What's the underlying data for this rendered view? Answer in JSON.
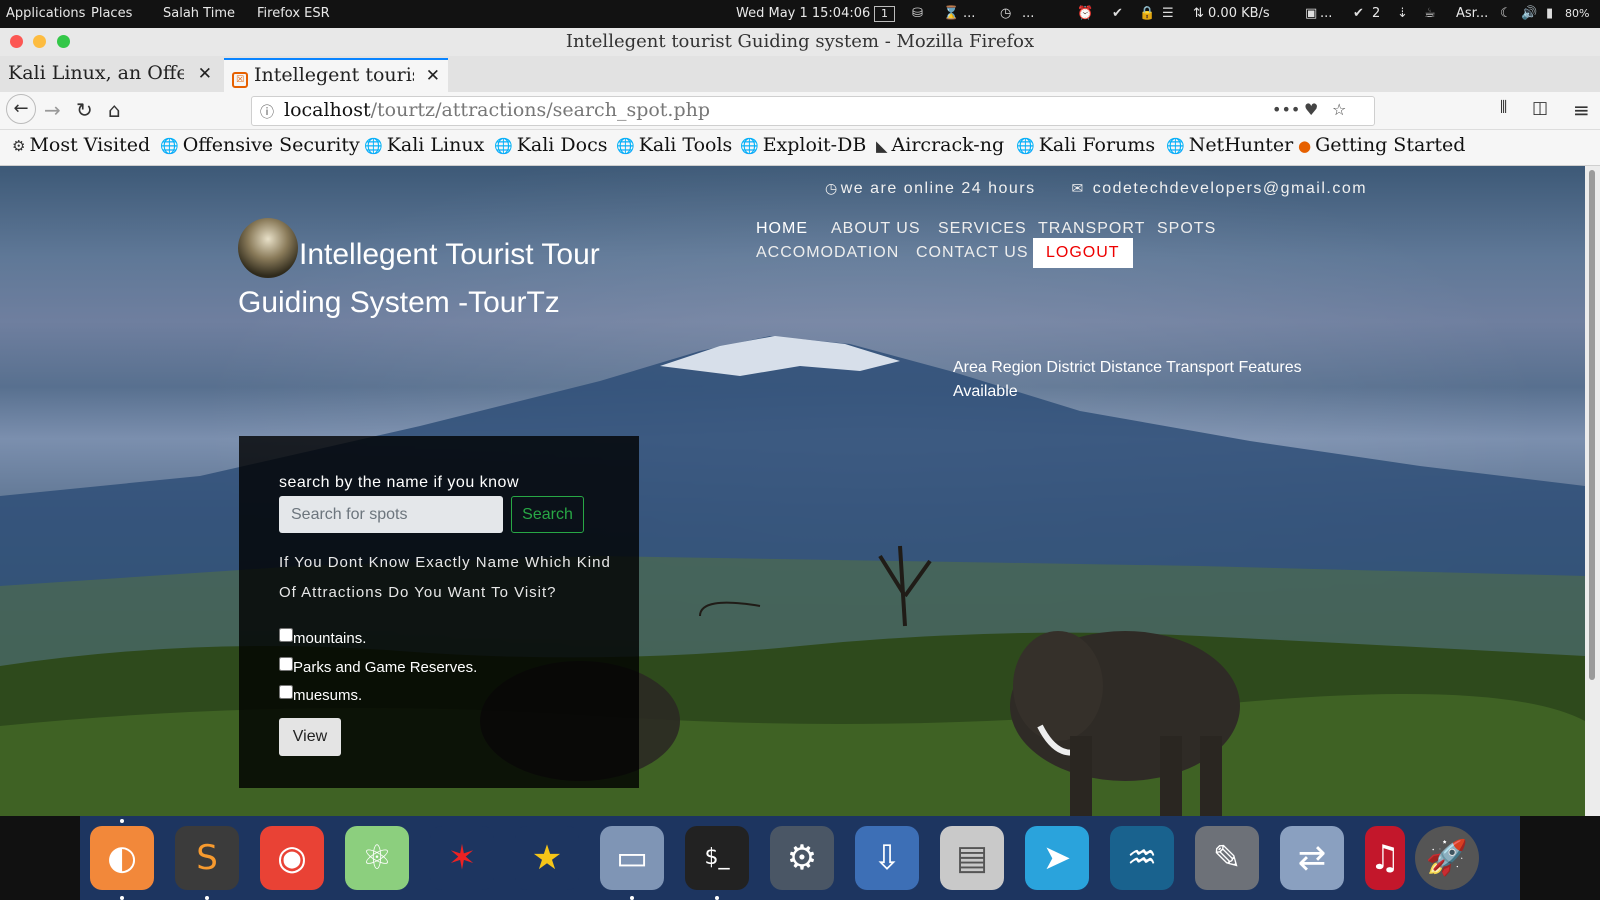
{
  "topbar": {
    "applications": "Applications",
    "places": "Places",
    "salah_time": "Salah Time",
    "firefox": "Firefox ESR",
    "datetime": "Wed May 1  15:04:06",
    "workspace": "1",
    "dots": "...",
    "dots2": "...",
    "net_speed": "⇅ 0.00 KB/s",
    "dots3": "...",
    "updates": "2",
    "prayer": "Asr...",
    "battery": "80%"
  },
  "window": {
    "title": "Intellegent tourist Guiding system - Mozilla Firefox"
  },
  "tabs": [
    {
      "label": "Kali Linux, an Offensive Security"
    },
    {
      "label": "Intellegent tourist Guiding system"
    }
  ],
  "urlbar": {
    "host": "localhost",
    "path": "/tourtz/attractions/search_spot.php"
  },
  "bookmarks": [
    {
      "label": "Most Visited",
      "icon": "gear-icon"
    },
    {
      "label": "Offensive Security",
      "icon": "globe-icon"
    },
    {
      "label": "Kali Linux",
      "icon": "globe-icon"
    },
    {
      "label": "Kali Docs",
      "icon": "globe-icon"
    },
    {
      "label": "Kali Tools",
      "icon": "globe-icon"
    },
    {
      "label": "Exploit-DB",
      "icon": "globe-icon"
    },
    {
      "label": "Aircrack-ng",
      "icon": "aircrack-icon"
    },
    {
      "label": "Kali Forums",
      "icon": "globe-icon"
    },
    {
      "label": "NetHunter",
      "icon": "globe-icon"
    },
    {
      "label": "Getting Started",
      "icon": "firefox-icon"
    }
  ],
  "site": {
    "contact": {
      "online": "we are online 24 hours",
      "email": "codetechdevelopers@gmail.com"
    },
    "brand_title": "Intellegent Tourist Tour Guiding System -TourTz",
    "nav": {
      "home": "HOME",
      "about": "ABOUT US",
      "services": "SERVICES",
      "transport": "TRANSPORT",
      "spots": "SPOTS",
      "accomodation": "ACCOMODATION",
      "contact": "CONTACT US",
      "logout": "LOGOUT"
    },
    "info_text": "Area Region District Distance Transport Features Available",
    "search": {
      "label": "search by the name if you know",
      "placeholder": "Search for spots",
      "button": "Search",
      "kind_question": "If You Dont Know Exactly Name Which Kind Of Attractions Do You Want To Visit?",
      "categories": [
        "mountains.",
        "Parks and Game Reserves.",
        "muesums."
      ],
      "view_button": "View"
    }
  },
  "colors": {
    "logout_text": "#ee0000",
    "search_button": "#28a745",
    "firefox_tab_accent": "#0a84ff",
    "dock_background": "#1d3560"
  },
  "dock": [
    {
      "icon": "firefox-icon"
    },
    {
      "icon": "sublime-text-icon"
    },
    {
      "icon": "chrome-icon"
    },
    {
      "icon": "atom-icon"
    },
    {
      "icon": "maltego-icon"
    },
    {
      "icon": "star-icon"
    },
    {
      "icon": "files-icon"
    },
    {
      "icon": "terminal-icon"
    },
    {
      "icon": "settings-icon"
    },
    {
      "icon": "software-install-icon"
    },
    {
      "icon": "radio-icon"
    },
    {
      "icon": "telegram-icon"
    },
    {
      "icon": "mysql-workbench-icon"
    },
    {
      "icon": "gimp-icon"
    },
    {
      "icon": "transfer-icon"
    },
    {
      "icon": "app-icon"
    },
    {
      "icon": "launcher-rocket-icon"
    }
  ]
}
